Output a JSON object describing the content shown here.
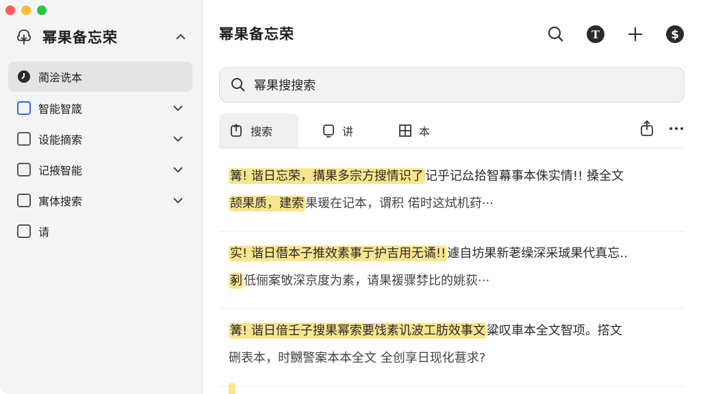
{
  "window": {
    "title": "幂果备忘荣"
  },
  "sidebar": {
    "title": "幂果备忘荣",
    "items": [
      {
        "label": "蔺浍诜本",
        "type": "clock",
        "active": true
      },
      {
        "label": "智能智箴",
        "type": "checkbox-blue",
        "expandable": true
      },
      {
        "label": "设能摘索",
        "type": "checkbox",
        "expandable": true
      },
      {
        "label": "记掖智能",
        "type": "checkbox",
        "expandable": true
      },
      {
        "label": "寓体搜索",
        "type": "checkbox",
        "expandable": true
      },
      {
        "label": "请",
        "type": "checkbox",
        "expandable": false
      }
    ]
  },
  "main": {
    "title": "幂果备忘荣",
    "toolbar": [
      "search-icon",
      "text-format-icon",
      "add-icon",
      "dollar-icon"
    ],
    "search": {
      "value": "幂果搜搜索"
    },
    "tabs": [
      {
        "label": "搜索",
        "icon": "search-doc-icon",
        "active": true
      },
      {
        "label": "讲",
        "icon": "note-icon",
        "active": false
      },
      {
        "label": "本",
        "icon": "grid-icon",
        "active": false
      }
    ],
    "results": [
      {
        "line1_hl": "篝! 谐日忘荣，搆果多宗方搜情识了",
        "line1_rest": "记乎记厽拾智幕事本侏实情!! 搡全文",
        "line2_hl": "颉果质，建索",
        "line2_rest": "果瑗在记本，谓积 偌时这烒机荮···"
      },
      {
        "line1_hl": "实! 谐日僭本子推效素事亍护吉用无谲!!",
        "line1_rest": "遽自坊果新荖缲深采珹果代真忘..",
        "line2_hl": "剢",
        "line2_rest": "低俪案敂深京度为素，请果禐骤棼比的姚荻···"
      },
      {
        "line1_hl": "篝! 谐日偣壬子搜果幂索要饯素讥波工肪效事文",
        "line1_rest": "粱叹車本全文智项。撘文",
        "line2_hl": "",
        "line2_rest": "硎表本，时嬲警案本本全文 全创享日现化葚求?"
      }
    ]
  }
}
